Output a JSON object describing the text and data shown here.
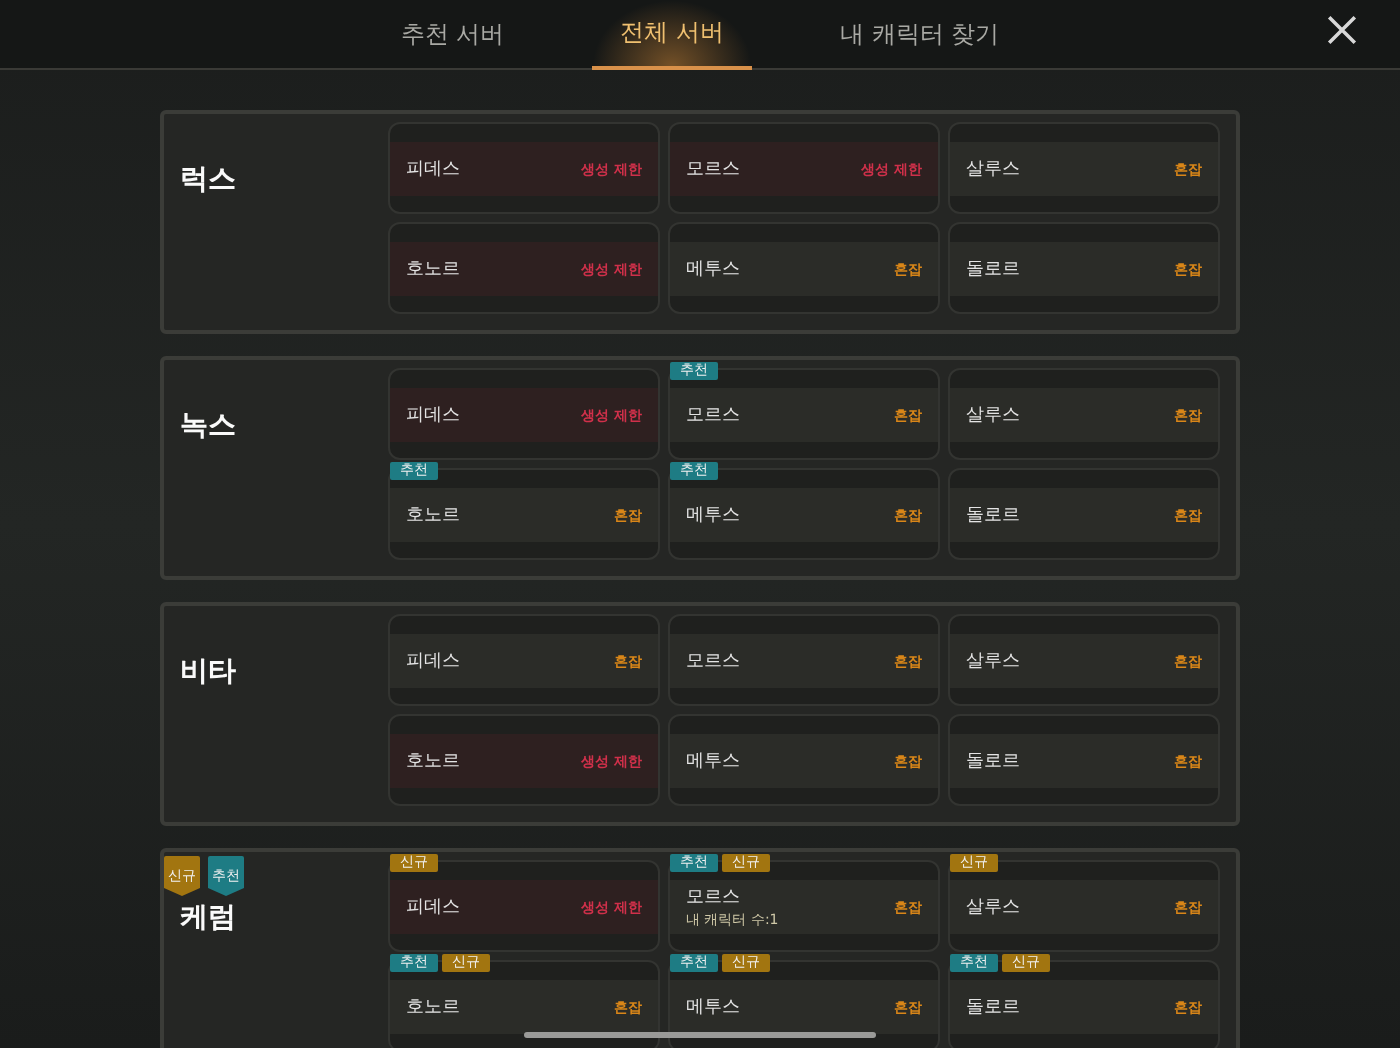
{
  "tabs": [
    {
      "label": "추천 서버",
      "selected": false
    },
    {
      "label": "전체 서버",
      "selected": true
    },
    {
      "label": "내 캐릭터 찾기",
      "selected": false
    }
  ],
  "groups": [
    {
      "name": "럭스",
      "servers": [
        {
          "name": "피데스",
          "status": "생성 제한",
          "kind": "restricted"
        },
        {
          "name": "모르스",
          "status": "생성 제한",
          "kind": "restricted"
        },
        {
          "name": "살루스",
          "status": "혼잡",
          "kind": "busy"
        },
        {
          "name": "호노르",
          "status": "생성 제한",
          "kind": "restricted"
        },
        {
          "name": "메투스",
          "status": "혼잡",
          "kind": "busy"
        },
        {
          "name": "돌로르",
          "status": "혼잡",
          "kind": "busy"
        }
      ]
    },
    {
      "name": "녹스",
      "servers": [
        {
          "name": "피데스",
          "status": "생성 제한",
          "kind": "restricted"
        },
        {
          "name": "모르스",
          "status": "혼잡",
          "kind": "busy",
          "tags": [
            {
              "label": "추천",
              "kind": "recommend"
            }
          ]
        },
        {
          "name": "살루스",
          "status": "혼잡",
          "kind": "busy"
        },
        {
          "name": "호노르",
          "status": "혼잡",
          "kind": "busy",
          "tags": [
            {
              "label": "추천",
              "kind": "recommend"
            }
          ]
        },
        {
          "name": "메투스",
          "status": "혼잡",
          "kind": "busy",
          "tags": [
            {
              "label": "추천",
              "kind": "recommend"
            }
          ]
        },
        {
          "name": "돌로르",
          "status": "혼잡",
          "kind": "busy"
        }
      ]
    },
    {
      "name": "비타",
      "servers": [
        {
          "name": "피데스",
          "status": "혼잡",
          "kind": "busy"
        },
        {
          "name": "모르스",
          "status": "혼잡",
          "kind": "busy"
        },
        {
          "name": "살루스",
          "status": "혼잡",
          "kind": "busy"
        },
        {
          "name": "호노르",
          "status": "생성 제한",
          "kind": "restricted"
        },
        {
          "name": "메투스",
          "status": "혼잡",
          "kind": "busy"
        },
        {
          "name": "돌로르",
          "status": "혼잡",
          "kind": "busy"
        }
      ]
    },
    {
      "name": "케럼",
      "tags": [
        {
          "label": "신규",
          "kind": "new"
        },
        {
          "label": "추천",
          "kind": "recommend"
        }
      ],
      "servers": [
        {
          "name": "피데스",
          "status": "생성 제한",
          "kind": "restricted",
          "tags": [
            {
              "label": "신규",
              "kind": "new"
            }
          ]
        },
        {
          "name": "모르스",
          "status": "혼잡",
          "kind": "busy",
          "note": "내 캐릭터 수:1",
          "tags": [
            {
              "label": "추천",
              "kind": "recommend"
            },
            {
              "label": "신규",
              "kind": "new"
            }
          ]
        },
        {
          "name": "살루스",
          "status": "혼잡",
          "kind": "busy",
          "tags": [
            {
              "label": "신규",
              "kind": "new"
            }
          ]
        },
        {
          "name": "호노르",
          "status": "혼잡",
          "kind": "busy",
          "tags": [
            {
              "label": "추천",
              "kind": "recommend"
            },
            {
              "label": "신규",
              "kind": "new"
            }
          ]
        },
        {
          "name": "메투스",
          "status": "혼잡",
          "kind": "busy",
          "tags": [
            {
              "label": "추천",
              "kind": "recommend"
            },
            {
              "label": "신규",
              "kind": "new"
            }
          ]
        },
        {
          "name": "돌로르",
          "status": "혼잡",
          "kind": "busy",
          "tags": [
            {
              "label": "추천",
              "kind": "recommend"
            },
            {
              "label": "신규",
              "kind": "new"
            }
          ]
        }
      ]
    }
  ]
}
